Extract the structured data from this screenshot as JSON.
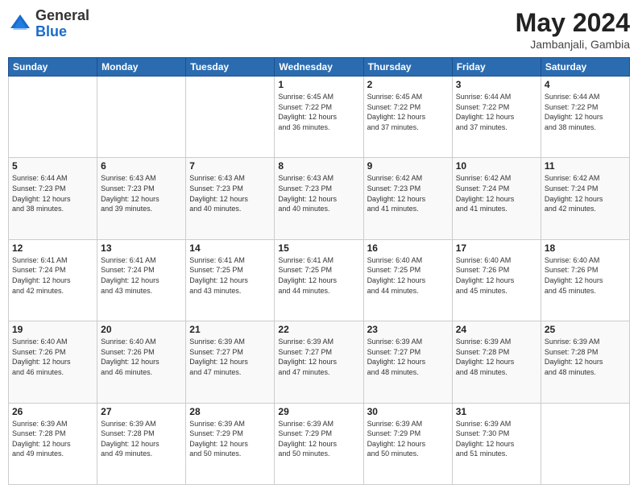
{
  "header": {
    "logo_line1": "General",
    "logo_line2": "Blue",
    "month_year": "May 2024",
    "location": "Jambanjali, Gambia"
  },
  "weekdays": [
    "Sunday",
    "Monday",
    "Tuesday",
    "Wednesday",
    "Thursday",
    "Friday",
    "Saturday"
  ],
  "weeks": [
    [
      {
        "day": "",
        "info": ""
      },
      {
        "day": "",
        "info": ""
      },
      {
        "day": "",
        "info": ""
      },
      {
        "day": "1",
        "info": "Sunrise: 6:45 AM\nSunset: 7:22 PM\nDaylight: 12 hours\nand 36 minutes."
      },
      {
        "day": "2",
        "info": "Sunrise: 6:45 AM\nSunset: 7:22 PM\nDaylight: 12 hours\nand 37 minutes."
      },
      {
        "day": "3",
        "info": "Sunrise: 6:44 AM\nSunset: 7:22 PM\nDaylight: 12 hours\nand 37 minutes."
      },
      {
        "day": "4",
        "info": "Sunrise: 6:44 AM\nSunset: 7:22 PM\nDaylight: 12 hours\nand 38 minutes."
      }
    ],
    [
      {
        "day": "5",
        "info": "Sunrise: 6:44 AM\nSunset: 7:23 PM\nDaylight: 12 hours\nand 38 minutes."
      },
      {
        "day": "6",
        "info": "Sunrise: 6:43 AM\nSunset: 7:23 PM\nDaylight: 12 hours\nand 39 minutes."
      },
      {
        "day": "7",
        "info": "Sunrise: 6:43 AM\nSunset: 7:23 PM\nDaylight: 12 hours\nand 40 minutes."
      },
      {
        "day": "8",
        "info": "Sunrise: 6:43 AM\nSunset: 7:23 PM\nDaylight: 12 hours\nand 40 minutes."
      },
      {
        "day": "9",
        "info": "Sunrise: 6:42 AM\nSunset: 7:23 PM\nDaylight: 12 hours\nand 41 minutes."
      },
      {
        "day": "10",
        "info": "Sunrise: 6:42 AM\nSunset: 7:24 PM\nDaylight: 12 hours\nand 41 minutes."
      },
      {
        "day": "11",
        "info": "Sunrise: 6:42 AM\nSunset: 7:24 PM\nDaylight: 12 hours\nand 42 minutes."
      }
    ],
    [
      {
        "day": "12",
        "info": "Sunrise: 6:41 AM\nSunset: 7:24 PM\nDaylight: 12 hours\nand 42 minutes."
      },
      {
        "day": "13",
        "info": "Sunrise: 6:41 AM\nSunset: 7:24 PM\nDaylight: 12 hours\nand 43 minutes."
      },
      {
        "day": "14",
        "info": "Sunrise: 6:41 AM\nSunset: 7:25 PM\nDaylight: 12 hours\nand 43 minutes."
      },
      {
        "day": "15",
        "info": "Sunrise: 6:41 AM\nSunset: 7:25 PM\nDaylight: 12 hours\nand 44 minutes."
      },
      {
        "day": "16",
        "info": "Sunrise: 6:40 AM\nSunset: 7:25 PM\nDaylight: 12 hours\nand 44 minutes."
      },
      {
        "day": "17",
        "info": "Sunrise: 6:40 AM\nSunset: 7:26 PM\nDaylight: 12 hours\nand 45 minutes."
      },
      {
        "day": "18",
        "info": "Sunrise: 6:40 AM\nSunset: 7:26 PM\nDaylight: 12 hours\nand 45 minutes."
      }
    ],
    [
      {
        "day": "19",
        "info": "Sunrise: 6:40 AM\nSunset: 7:26 PM\nDaylight: 12 hours\nand 46 minutes."
      },
      {
        "day": "20",
        "info": "Sunrise: 6:40 AM\nSunset: 7:26 PM\nDaylight: 12 hours\nand 46 minutes."
      },
      {
        "day": "21",
        "info": "Sunrise: 6:39 AM\nSunset: 7:27 PM\nDaylight: 12 hours\nand 47 minutes."
      },
      {
        "day": "22",
        "info": "Sunrise: 6:39 AM\nSunset: 7:27 PM\nDaylight: 12 hours\nand 47 minutes."
      },
      {
        "day": "23",
        "info": "Sunrise: 6:39 AM\nSunset: 7:27 PM\nDaylight: 12 hours\nand 48 minutes."
      },
      {
        "day": "24",
        "info": "Sunrise: 6:39 AM\nSunset: 7:28 PM\nDaylight: 12 hours\nand 48 minutes."
      },
      {
        "day": "25",
        "info": "Sunrise: 6:39 AM\nSunset: 7:28 PM\nDaylight: 12 hours\nand 48 minutes."
      }
    ],
    [
      {
        "day": "26",
        "info": "Sunrise: 6:39 AM\nSunset: 7:28 PM\nDaylight: 12 hours\nand 49 minutes."
      },
      {
        "day": "27",
        "info": "Sunrise: 6:39 AM\nSunset: 7:28 PM\nDaylight: 12 hours\nand 49 minutes."
      },
      {
        "day": "28",
        "info": "Sunrise: 6:39 AM\nSunset: 7:29 PM\nDaylight: 12 hours\nand 50 minutes."
      },
      {
        "day": "29",
        "info": "Sunrise: 6:39 AM\nSunset: 7:29 PM\nDaylight: 12 hours\nand 50 minutes."
      },
      {
        "day": "30",
        "info": "Sunrise: 6:39 AM\nSunset: 7:29 PM\nDaylight: 12 hours\nand 50 minutes."
      },
      {
        "day": "31",
        "info": "Sunrise: 6:39 AM\nSunset: 7:30 PM\nDaylight: 12 hours\nand 51 minutes."
      },
      {
        "day": "",
        "info": ""
      }
    ]
  ]
}
